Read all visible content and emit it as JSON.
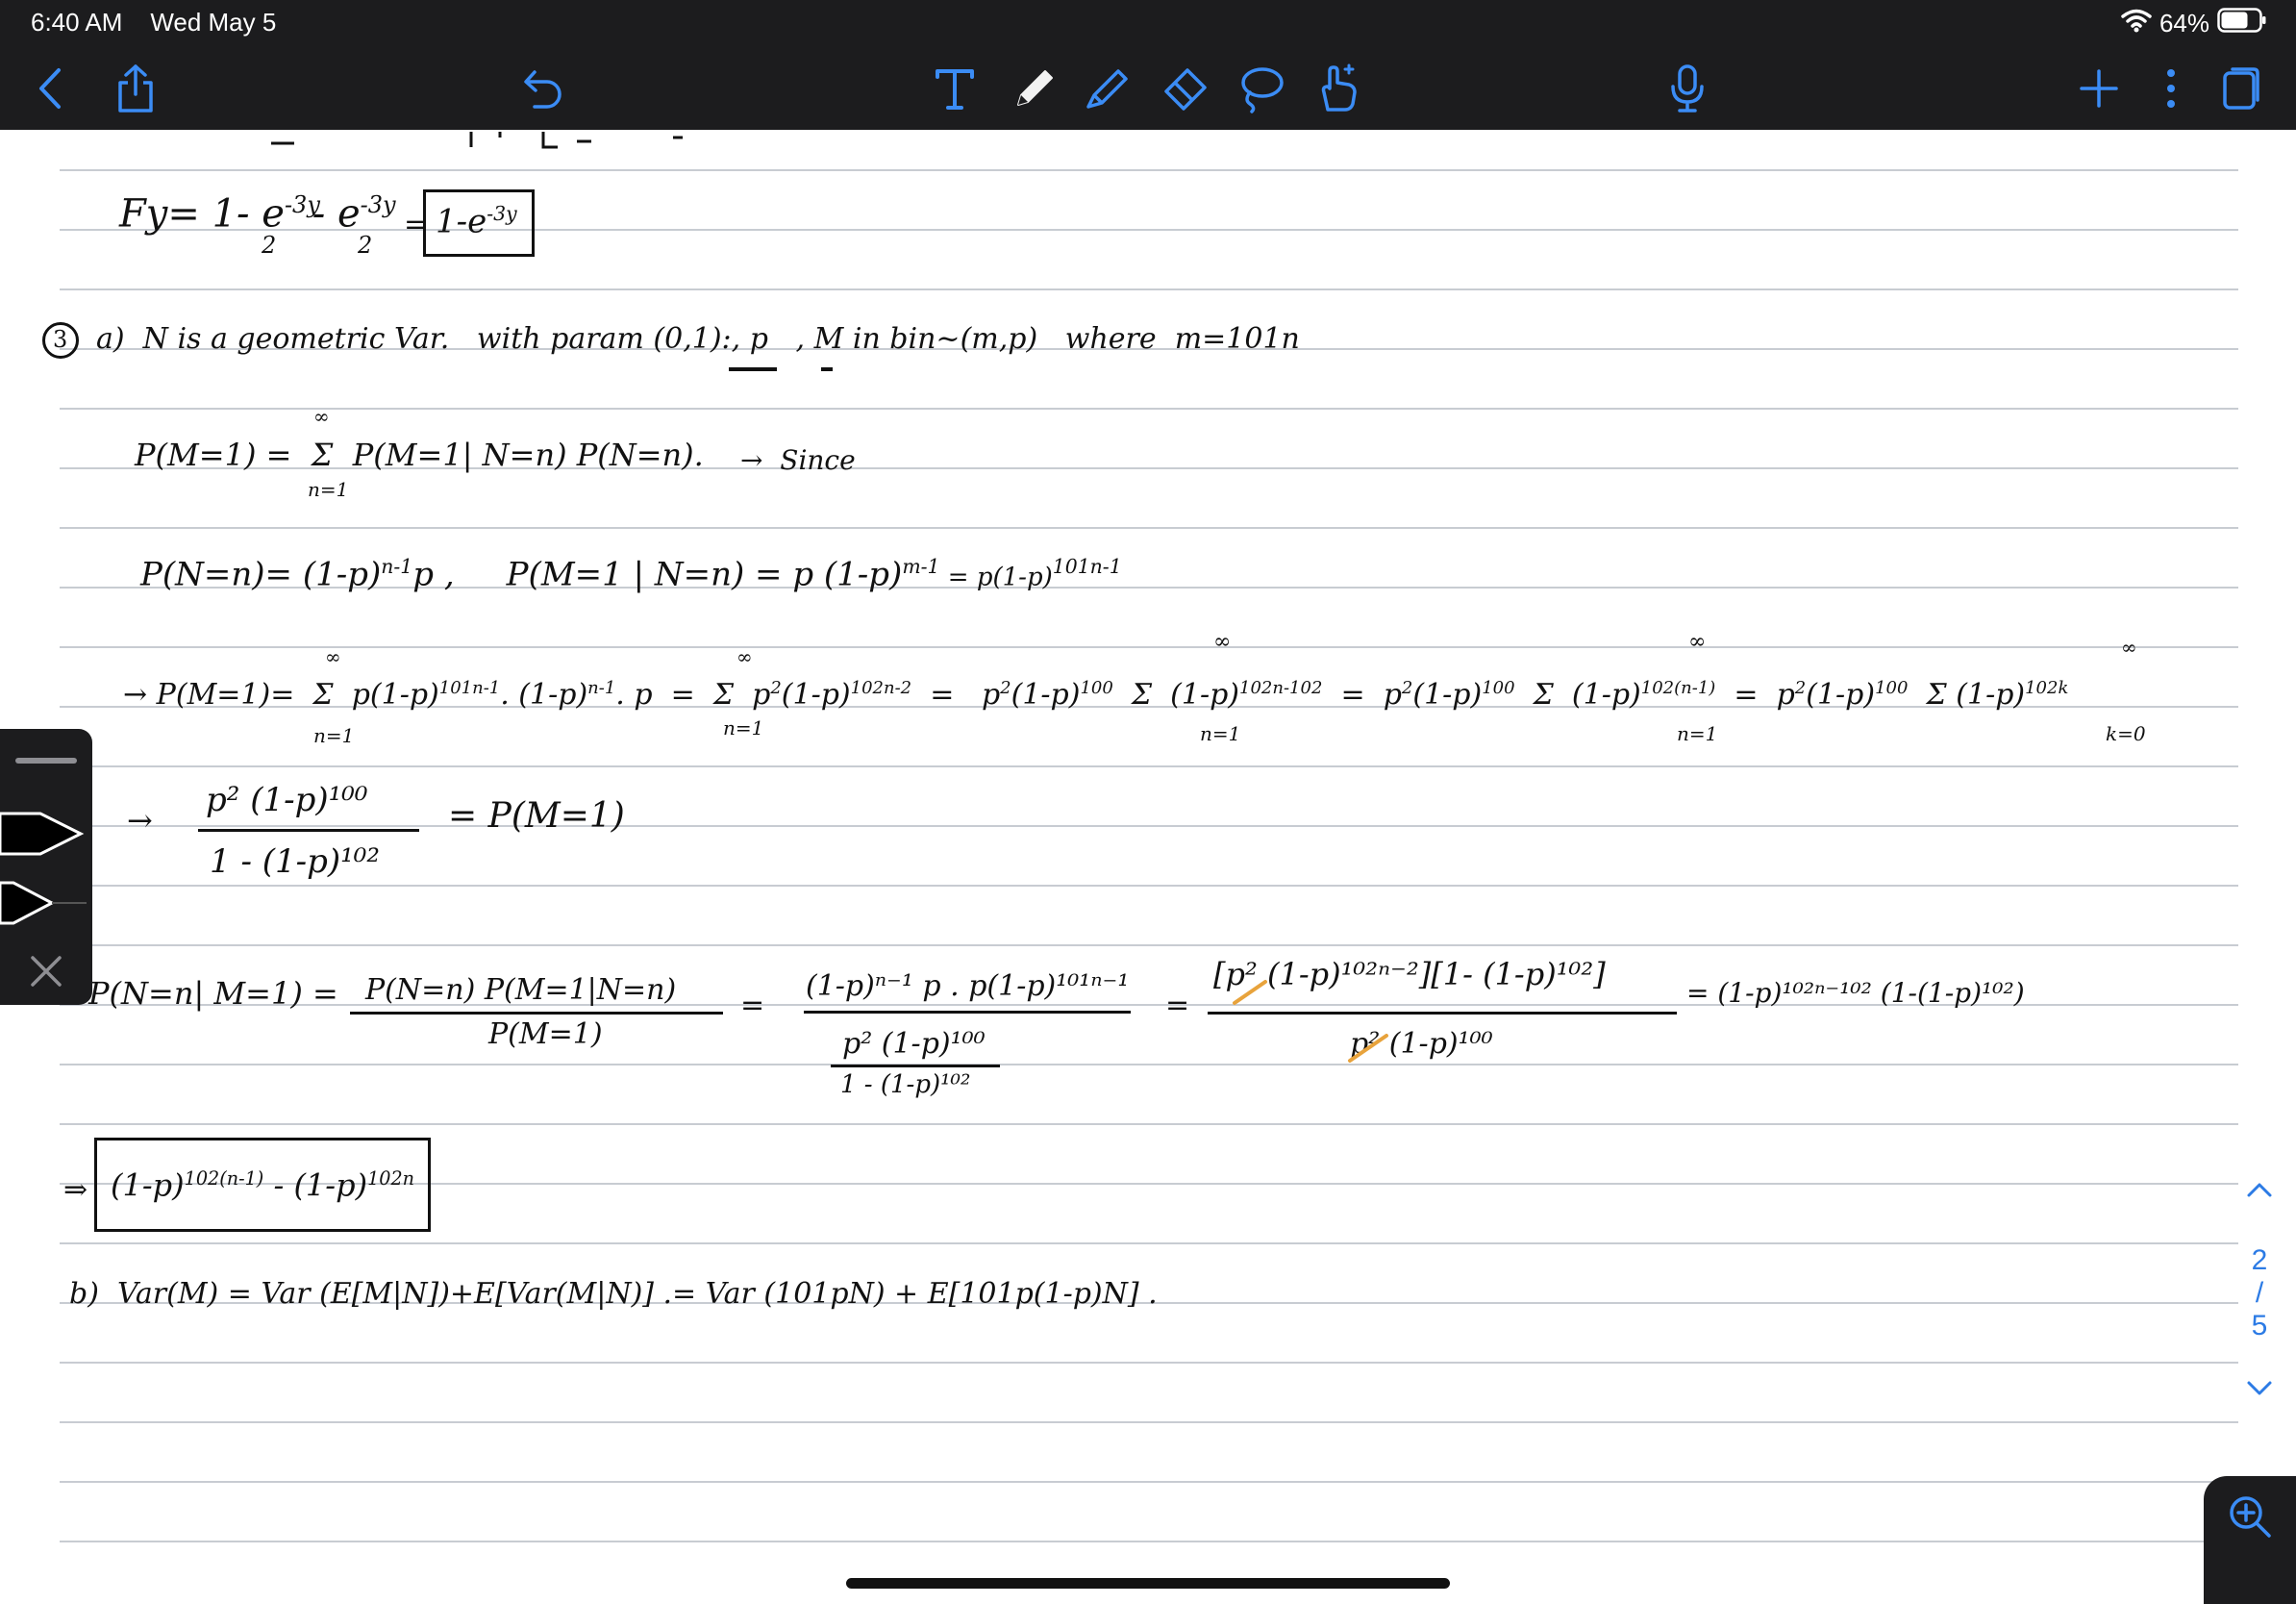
{
  "status_bar": {
    "time": "6:40 AM",
    "date": "Wed May 5",
    "battery": "64%"
  },
  "toolbar": {
    "icons": [
      "back-chevron-icon",
      "share-icon",
      "undo-icon",
      "text-tool-icon",
      "pen-icon",
      "highlighter-icon",
      "eraser-icon",
      "lasso-icon",
      "hand-pointer-icon",
      "microphone-icon",
      "add-icon",
      "more-icon",
      "pages-icon"
    ]
  },
  "notes": {
    "line1": "Fy= 1- e",
    "line1_exp": "-3y",
    "line1_den": "2",
    "line1_mid": " - e",
    "line1_exp2": "-3y",
    "line1_den2": "2",
    "line1_eq": "=",
    "line1_box": "1-e",
    "line1_box_exp": "-3y",
    "q3_label": "3",
    "q3a": "a)  N is a geometric Var.   with param (0,1):, p   , M in bin~(m,p)   where  m=101n",
    "eq1": "P(M=1) =  Σ  P(M=1| N=n) P(N=n).",
    "eq1_top": "∞",
    "eq1_bottom": "n=1",
    "eq1_since": "→  Since",
    "eq2": "P(N=n)= (1-p)",
    "eq2_exp": "n-1",
    "eq2_b": "p ,     P(M=1 | N=n) = p (1-p)",
    "eq2_exp2": "m-1",
    "eq2_c": " = p(1-p)",
    "eq2_exp3": "101n-1",
    "eq3_a": "→ P(M=1)=  Σ  p(1-p)",
    "eq3_exp1": "101n-1",
    "eq3_b": ". (1-p)",
    "eq3_exp2": "n-1",
    "eq3_c": ". p  =  Σ  p",
    "eq3_exp3": "2",
    "eq3_d": "(1-p)",
    "eq3_exp4": "102n-2",
    "eq3_e": "  =   p",
    "eq3_exp5": "2",
    "eq3_f": "(1-p)",
    "eq3_exp6": "100",
    "eq3_g": "  Σ  (1-p)",
    "eq3_exp7": "102n-102",
    "eq3_h": "  =  p",
    "eq3_exp8": "2",
    "eq3_i": "(1-p)",
    "eq3_exp9": "100",
    "eq3_j": "  Σ  (1-p)",
    "eq3_exp10": "102(n-1)",
    "eq3_k": "  =  p",
    "eq3_exp11": "2",
    "eq3_l": "(1-p)",
    "eq3_exp12": "100",
    "eq3_m": "  Σ (1-p)",
    "eq3_exp13": "102k",
    "eq3_inf": "∞",
    "eq3_n1": "n=1",
    "eq3_k0": "k=0",
    "eq4_arrow": "→",
    "eq4_num": "p² (1-p)¹⁰⁰",
    "eq4_den": "1 - (1-p)¹⁰²",
    "eq4_rhs": "= P(M=1)",
    "eq5_lhs": "P(N=n| M=1) =",
    "eq5_num1": "P(N=n) P(M=1|N=n)",
    "eq5_den1": "P(M=1)",
    "eq5_eq1": "=",
    "eq5_num2": "(1-p)ⁿ⁻¹ p . p(1-p)¹⁰¹ⁿ⁻¹",
    "eq5_den2a": "p² (1-p)¹⁰⁰",
    "eq5_den2b": "1 - (1-p)¹⁰²",
    "eq5_eq2": "=",
    "eq5_num3": "[p² (1-p)¹⁰²ⁿ⁻²][1- (1-p)¹⁰²]",
    "eq5_den3": "p² (1-p)¹⁰⁰",
    "eq5_rhs": "= (1-p)¹⁰²ⁿ⁻¹⁰² (1-(1-p)¹⁰²)",
    "eq6_arrow": "⇒",
    "eq6_box": "(1-p)",
    "eq6_exp1": "102(n-1)",
    "eq6_mid": " - (1-p)",
    "eq6_exp2": "102n",
    "eq7": "b)  Var(M) = Var (E[M|N])+E[Var(M|N)] .= Var (101pN) + E[101p(1-p)N] ."
  },
  "pager": {
    "current": "2",
    "separator": "/",
    "total": "5"
  },
  "colors": {
    "toolbar_bg": "#1c1c1e",
    "accent": "#2c7be5",
    "ink": "#111111",
    "ruled": "#c8ccd2",
    "crossed_out": "#e8a33c"
  }
}
